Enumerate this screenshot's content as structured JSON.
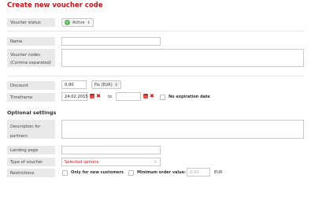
{
  "page": {
    "title": "Create new voucher code"
  },
  "voucher_status": {
    "label": "Voucher status",
    "value": "Active",
    "status_color": "#5cb85c"
  },
  "name": {
    "label": "Name",
    "value": ""
  },
  "voucher_codes": {
    "label": "Voucher codes",
    "hint": "(Comma separated)",
    "value": ""
  },
  "discount": {
    "label": "Discount",
    "value": "0.00",
    "unit_option": "Fix (EUR)"
  },
  "timeframe": {
    "label": "Timeframe",
    "start": "24.02.2015",
    "to_label": "to",
    "end": "",
    "no_expiration_label": "No expiration date"
  },
  "optional": {
    "heading": "Optional settings",
    "description": {
      "label": "Description for partners",
      "value": ""
    },
    "landing_page": {
      "label": "Landing page",
      "value": ""
    },
    "type_of_voucher": {
      "label": "Type of voucher",
      "value": "Selected options"
    },
    "restrictions": {
      "label": "Restrictions",
      "only_new_customers_label": "Only for new customers",
      "min_order_label": "Minimum order value:",
      "min_order_placeholder": "0.00",
      "currency": "EUR"
    }
  },
  "colors": {
    "accent": "#c4161c",
    "label_bg": "#e9e9e9"
  }
}
